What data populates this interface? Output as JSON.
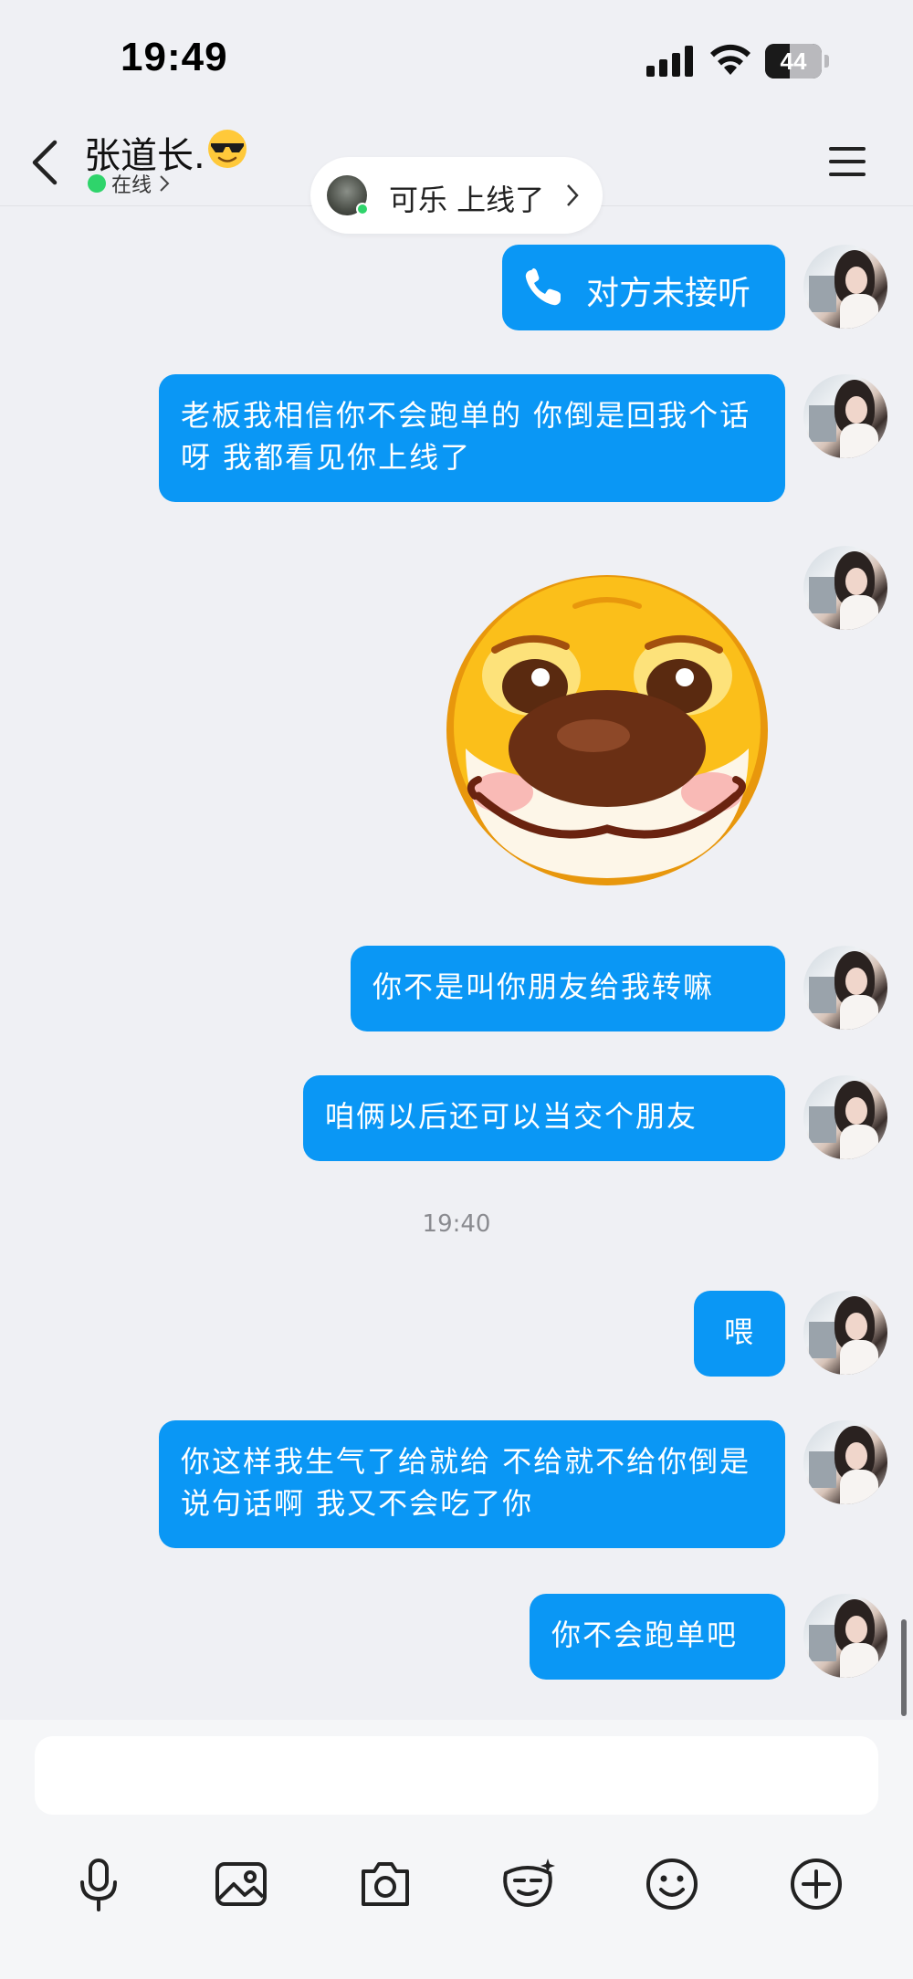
{
  "status_bar": {
    "time": "19:49",
    "battery": "44",
    "battery_level": 0.44
  },
  "header": {
    "contact_name": "张道长.",
    "status": "在线",
    "online_color": "#2fd46b"
  },
  "toast": {
    "text": "可乐 上线了"
  },
  "messages": [
    {
      "type": "call",
      "text": "对方未接听"
    },
    {
      "type": "text",
      "text": "老板我相信你不会跑单的 你倒是回我个话呀 我都看见你上线了"
    },
    {
      "type": "sticker",
      "icon": "dog-sticker"
    },
    {
      "type": "text",
      "text": "你不是叫你朋友给我转嘛"
    },
    {
      "type": "text",
      "text": "咱俩以后还可以当交个朋友"
    },
    {
      "type": "timestamp",
      "text": "19:40"
    },
    {
      "type": "text",
      "text": "喂"
    },
    {
      "type": "text",
      "text": "你这样我生气了给就给 不给就不给你倒是说句话啊 我又不会吃了你"
    },
    {
      "type": "text",
      "text": "你不会跑单吧"
    }
  ],
  "input": {
    "placeholder": ""
  },
  "toolbar": {
    "items": [
      "microphone-icon",
      "image-icon",
      "camera-icon",
      "sticker-icon",
      "emoji-icon",
      "plus-icon"
    ]
  },
  "colors": {
    "bubble": "#0a97f5",
    "background": "#eff0f4"
  }
}
